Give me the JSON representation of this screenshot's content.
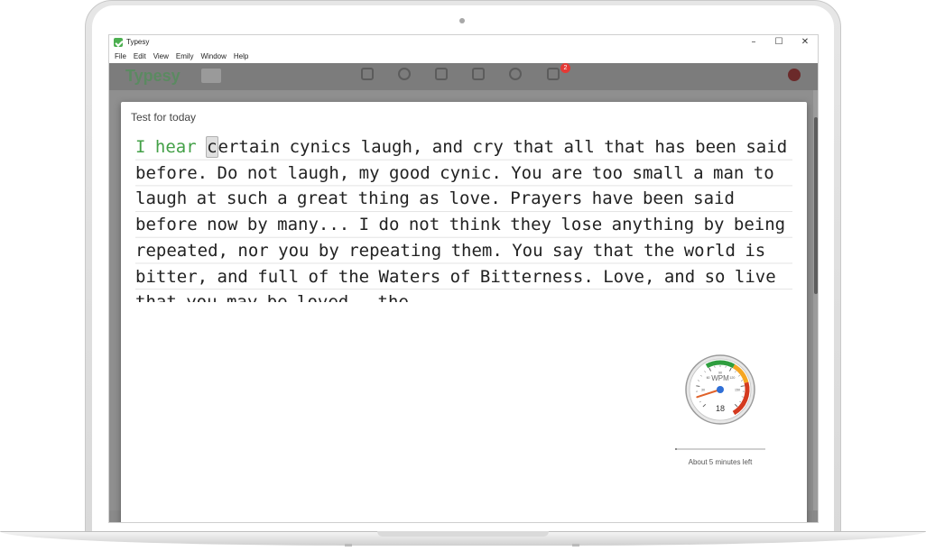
{
  "window": {
    "title": "Typesy"
  },
  "menu": [
    "File",
    "Edit",
    "View",
    "Emily",
    "Window",
    "Help"
  ],
  "window_controls": {
    "minimize": "–",
    "maximize": "☐",
    "close": "✕"
  },
  "app": {
    "brand": "Typesy",
    "notification_count": "2"
  },
  "modal": {
    "title": "Test for today",
    "typed_text": "I hear",
    "cursor_char": "c",
    "remaining_text": "ertain cynics laugh, and cry that all that has been said before. Do not laugh, my good cynic. You are too small a man to laugh at such a great thing as love. Prayers have been said before now by many... I do not think they lose anything by being repeated, nor you by repeating them. You say that the world is bitter, and full of the Waters of Bitterness. Love, and so live that you may be loved - the"
  },
  "gauge": {
    "label": "WPM",
    "value": "18",
    "tick_labels": [
      "30",
      "60",
      "90",
      "120",
      "150"
    ],
    "colors": {
      "green": "#2e9e3e",
      "orange": "#f5a623",
      "red": "#d43a1f",
      "needle": "#e0622a",
      "hub": "#2f6fd6"
    }
  },
  "progress": {
    "fraction": 0.02,
    "label": "About 5 minutes left"
  },
  "social_icons": [
    "facebook-icon",
    "twitter-icon",
    "instagram-icon",
    "youtube-icon"
  ]
}
